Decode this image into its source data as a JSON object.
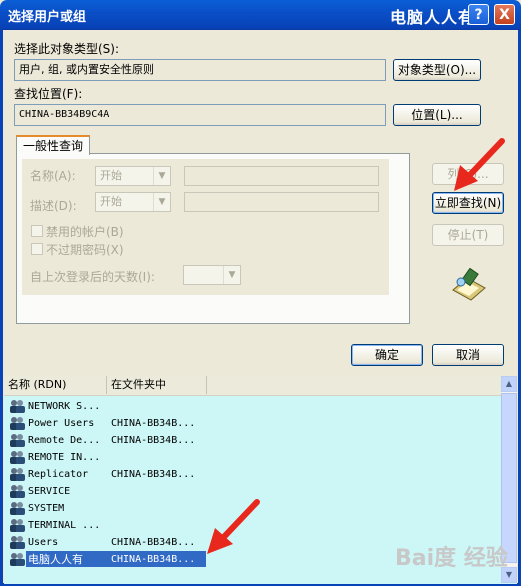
{
  "window": {
    "title": "选择用户或组",
    "brand": "电脑人人有",
    "help_button": "?",
    "close_button": "X"
  },
  "object_type": {
    "label": "选择此对象类型(S):",
    "value": "用户, 组, 或内置安全性原则",
    "button": "对象类型(O)..."
  },
  "location": {
    "label": "查找位置(F):",
    "value": "CHINA-BB34B9C4A",
    "button": "位置(L)..."
  },
  "tab": {
    "label": "一般性查询"
  },
  "query": {
    "name_label": "名称(A):",
    "name_mode": "开始",
    "desc_label": "描述(D):",
    "desc_mode": "开始",
    "disabled_accounts": "禁用的帐户(B)",
    "no_expire_pwd": "不过期密码(X)",
    "days_label": "自上次登录后的天数(I):"
  },
  "side_buttons": {
    "columns": "列(C)...",
    "find_now": "立即查找(N)",
    "stop": "停止(T)"
  },
  "dialog_buttons": {
    "ok": "确定",
    "cancel": "取消"
  },
  "results": {
    "col_name": "名称 (RDN)",
    "col_folder": "在文件夹中",
    "rows": [
      {
        "name": "NETWORK S...",
        "folder": ""
      },
      {
        "name": "Power Users",
        "folder": "CHINA-BB34B..."
      },
      {
        "name": "Remote De...",
        "folder": "CHINA-BB34B..."
      },
      {
        "name": "REMOTE IN...",
        "folder": ""
      },
      {
        "name": "Replicator",
        "folder": "CHINA-BB34B..."
      },
      {
        "name": "SERVICE",
        "folder": ""
      },
      {
        "name": "SYSTEM",
        "folder": ""
      },
      {
        "name": "TERMINAL ...",
        "folder": ""
      },
      {
        "name": "Users",
        "folder": "CHINA-BB34B..."
      },
      {
        "name": "电脑人人有",
        "folder": "CHINA-BB34B...",
        "selected": true
      }
    ]
  },
  "watermark": "Bai度 经验",
  "colors": {
    "titlebar": "#0a4fc8",
    "list_background": "#cdf6f6",
    "selection": "#316ac5",
    "arrow": "#e8281c"
  }
}
